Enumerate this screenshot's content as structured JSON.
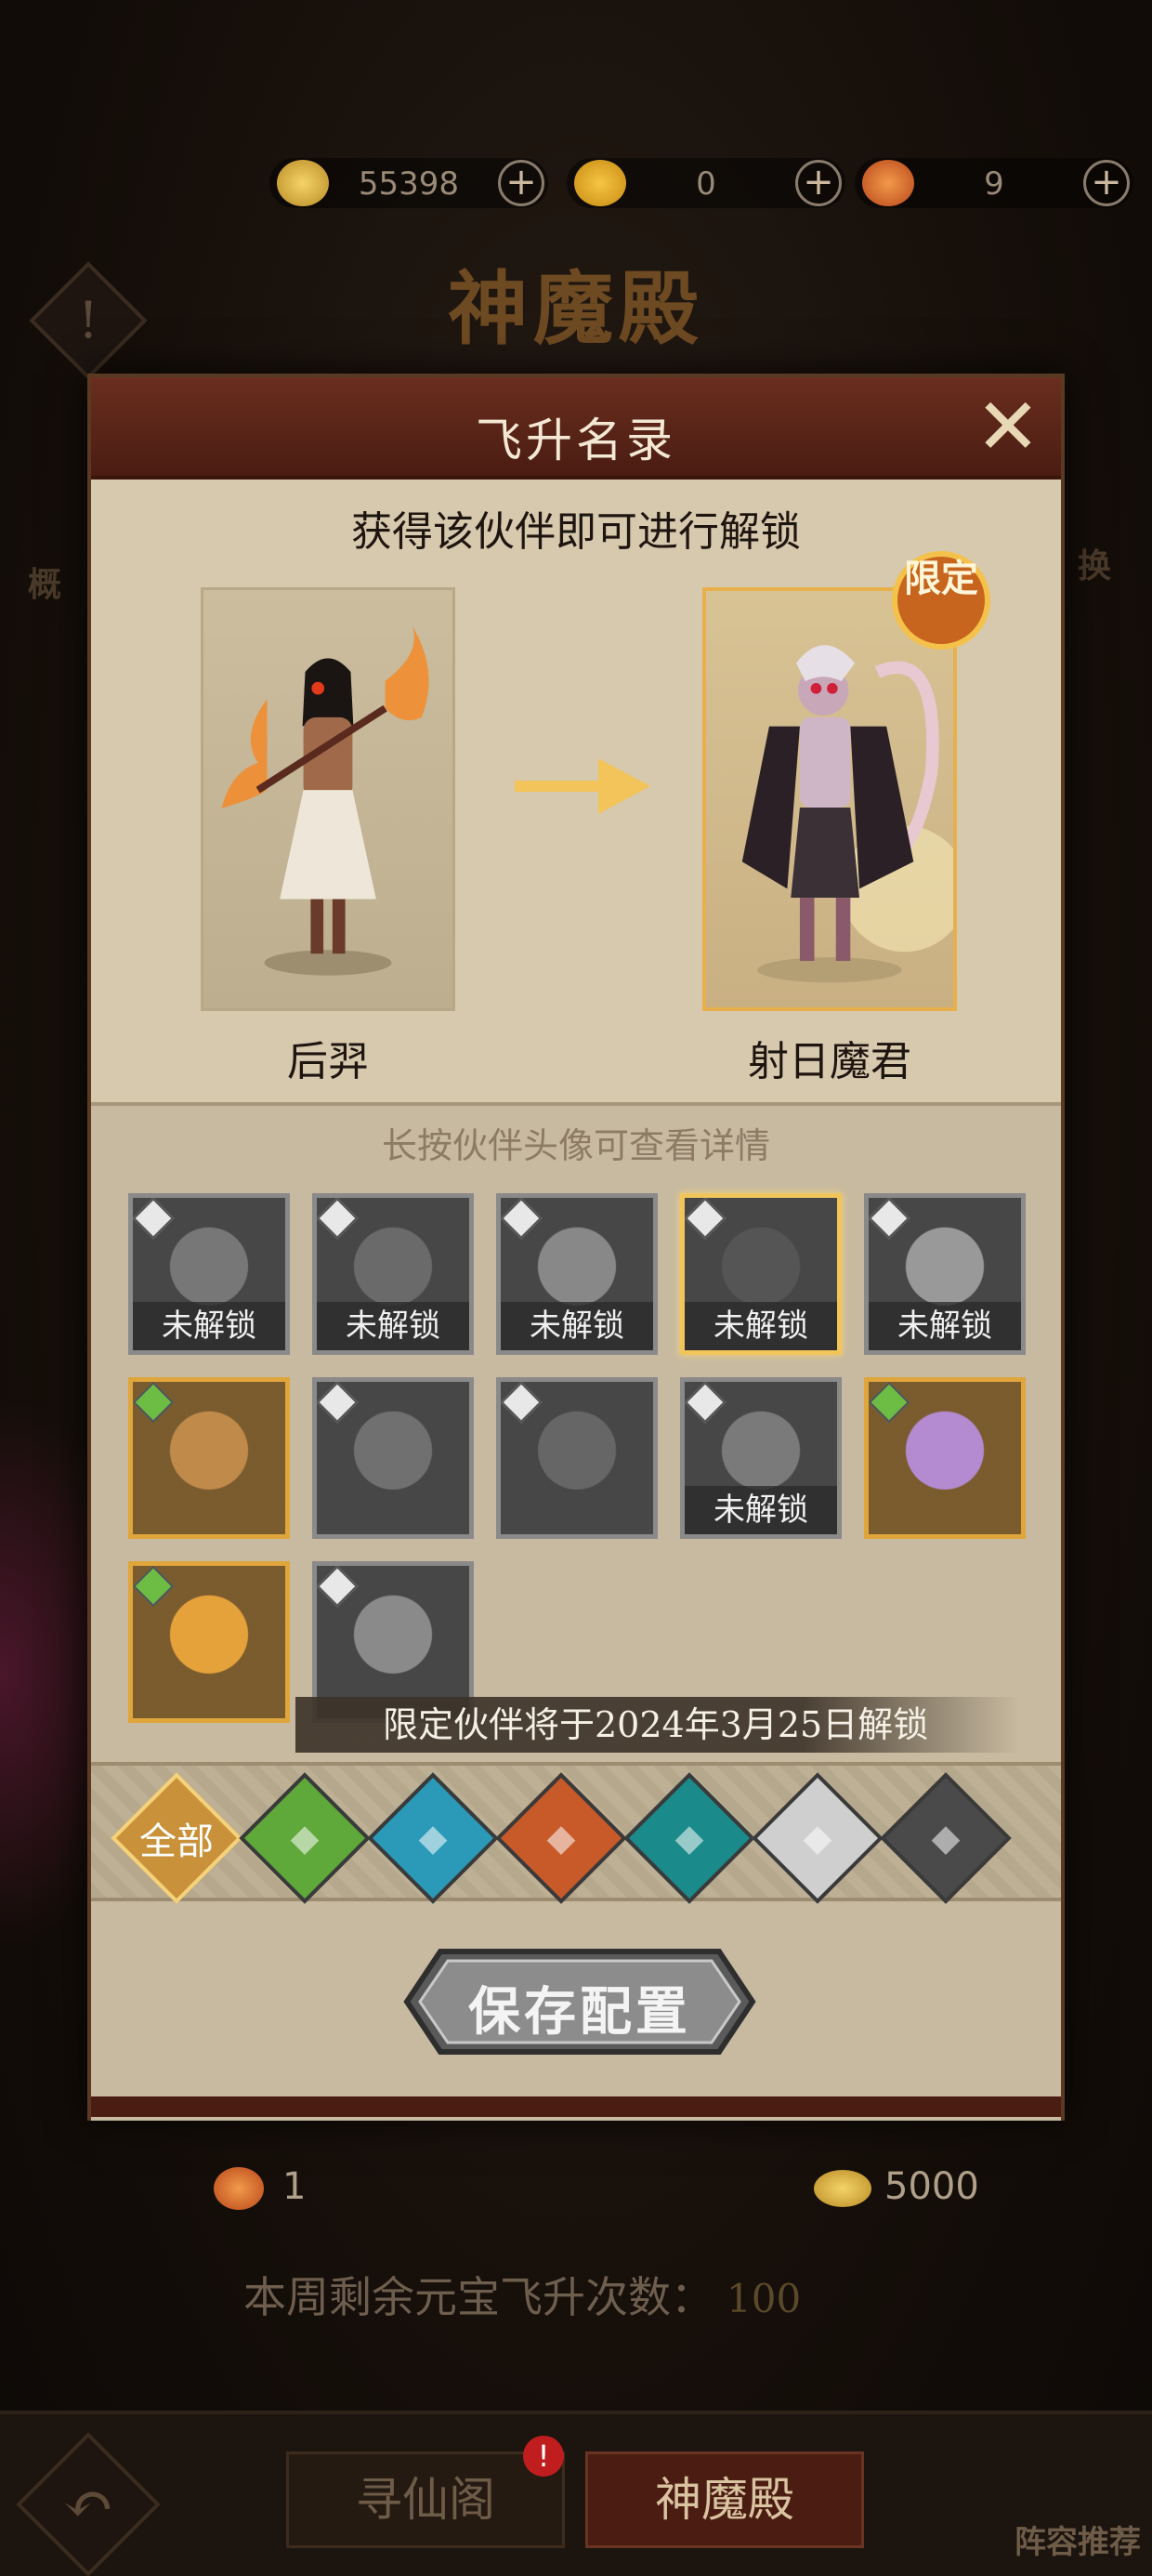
{
  "resources": [
    {
      "icon": "gold-ingot-icon",
      "value": "55398"
    },
    {
      "icon": "coin-icon",
      "value": "0"
    },
    {
      "icon": "ascension-token-icon",
      "value": "9"
    }
  ],
  "hall_title": "神魔殿",
  "side_labels": [
    "概",
    "换"
  ],
  "modal": {
    "title": "飞升名录",
    "subtitle": "获得该伙伴即可进行解锁",
    "from_name": "后羿",
    "to_name": "射日魔君",
    "limited_badge": "限定",
    "hint": "长按伙伴头像可查看详情",
    "locked_label": "未解锁",
    "cards": [
      {
        "state": "locked",
        "style": "gray",
        "face": "warrior-1"
      },
      {
        "state": "locked",
        "style": "gray",
        "face": "warrior-2"
      },
      {
        "state": "locked",
        "style": "gray",
        "face": "warrior-3"
      },
      {
        "state": "locked",
        "style": "highlight",
        "face": "warrior-4"
      },
      {
        "state": "locked",
        "style": "gray",
        "face": "warrior-5"
      },
      {
        "state": "unlocked",
        "style": "gold",
        "face": "warrior-6"
      },
      {
        "state": "unlocked",
        "style": "gray",
        "face": "warrior-7"
      },
      {
        "state": "unlocked",
        "style": "gray",
        "face": "warrior-8"
      },
      {
        "state": "locked",
        "style": "gray",
        "face": "warrior-9"
      },
      {
        "state": "unlocked",
        "style": "gold",
        "face": "warrior-10"
      },
      {
        "state": "unlocked",
        "style": "gold",
        "face": "warrior-11"
      },
      {
        "state": "unlocked",
        "style": "gray",
        "face": "warrior-12"
      }
    ],
    "limited_banner": "限定伙伴将于2024年3月25日解锁",
    "filters": [
      {
        "label": "全部",
        "icon": "all-filter",
        "color": "#c9923a"
      },
      {
        "label": "",
        "icon": "swallow-icon",
        "color": "#5fa83a"
      },
      {
        "label": "",
        "icon": "crane-icon",
        "color": "#2a9ab8"
      },
      {
        "label": "",
        "icon": "fox-icon",
        "color": "#c85a2a"
      },
      {
        "label": "",
        "icon": "beast-icon",
        "color": "#1a8a8a"
      },
      {
        "label": "",
        "icon": "dragon-icon",
        "color": "#cfcfcf"
      },
      {
        "label": "",
        "icon": "demon-icon",
        "color": "#4a4a4a"
      }
    ],
    "save_label": "保存配置"
  },
  "rewards": {
    "left_value": "1",
    "right_value": "5000"
  },
  "weekly": {
    "label": "本周剩余元宝飞升次数：",
    "value": "100"
  },
  "bottom_nav": {
    "tab1": "寻仙阁",
    "tab1_badge": "!",
    "tab2": "神魔殿",
    "lineup": "阵容推荐"
  }
}
